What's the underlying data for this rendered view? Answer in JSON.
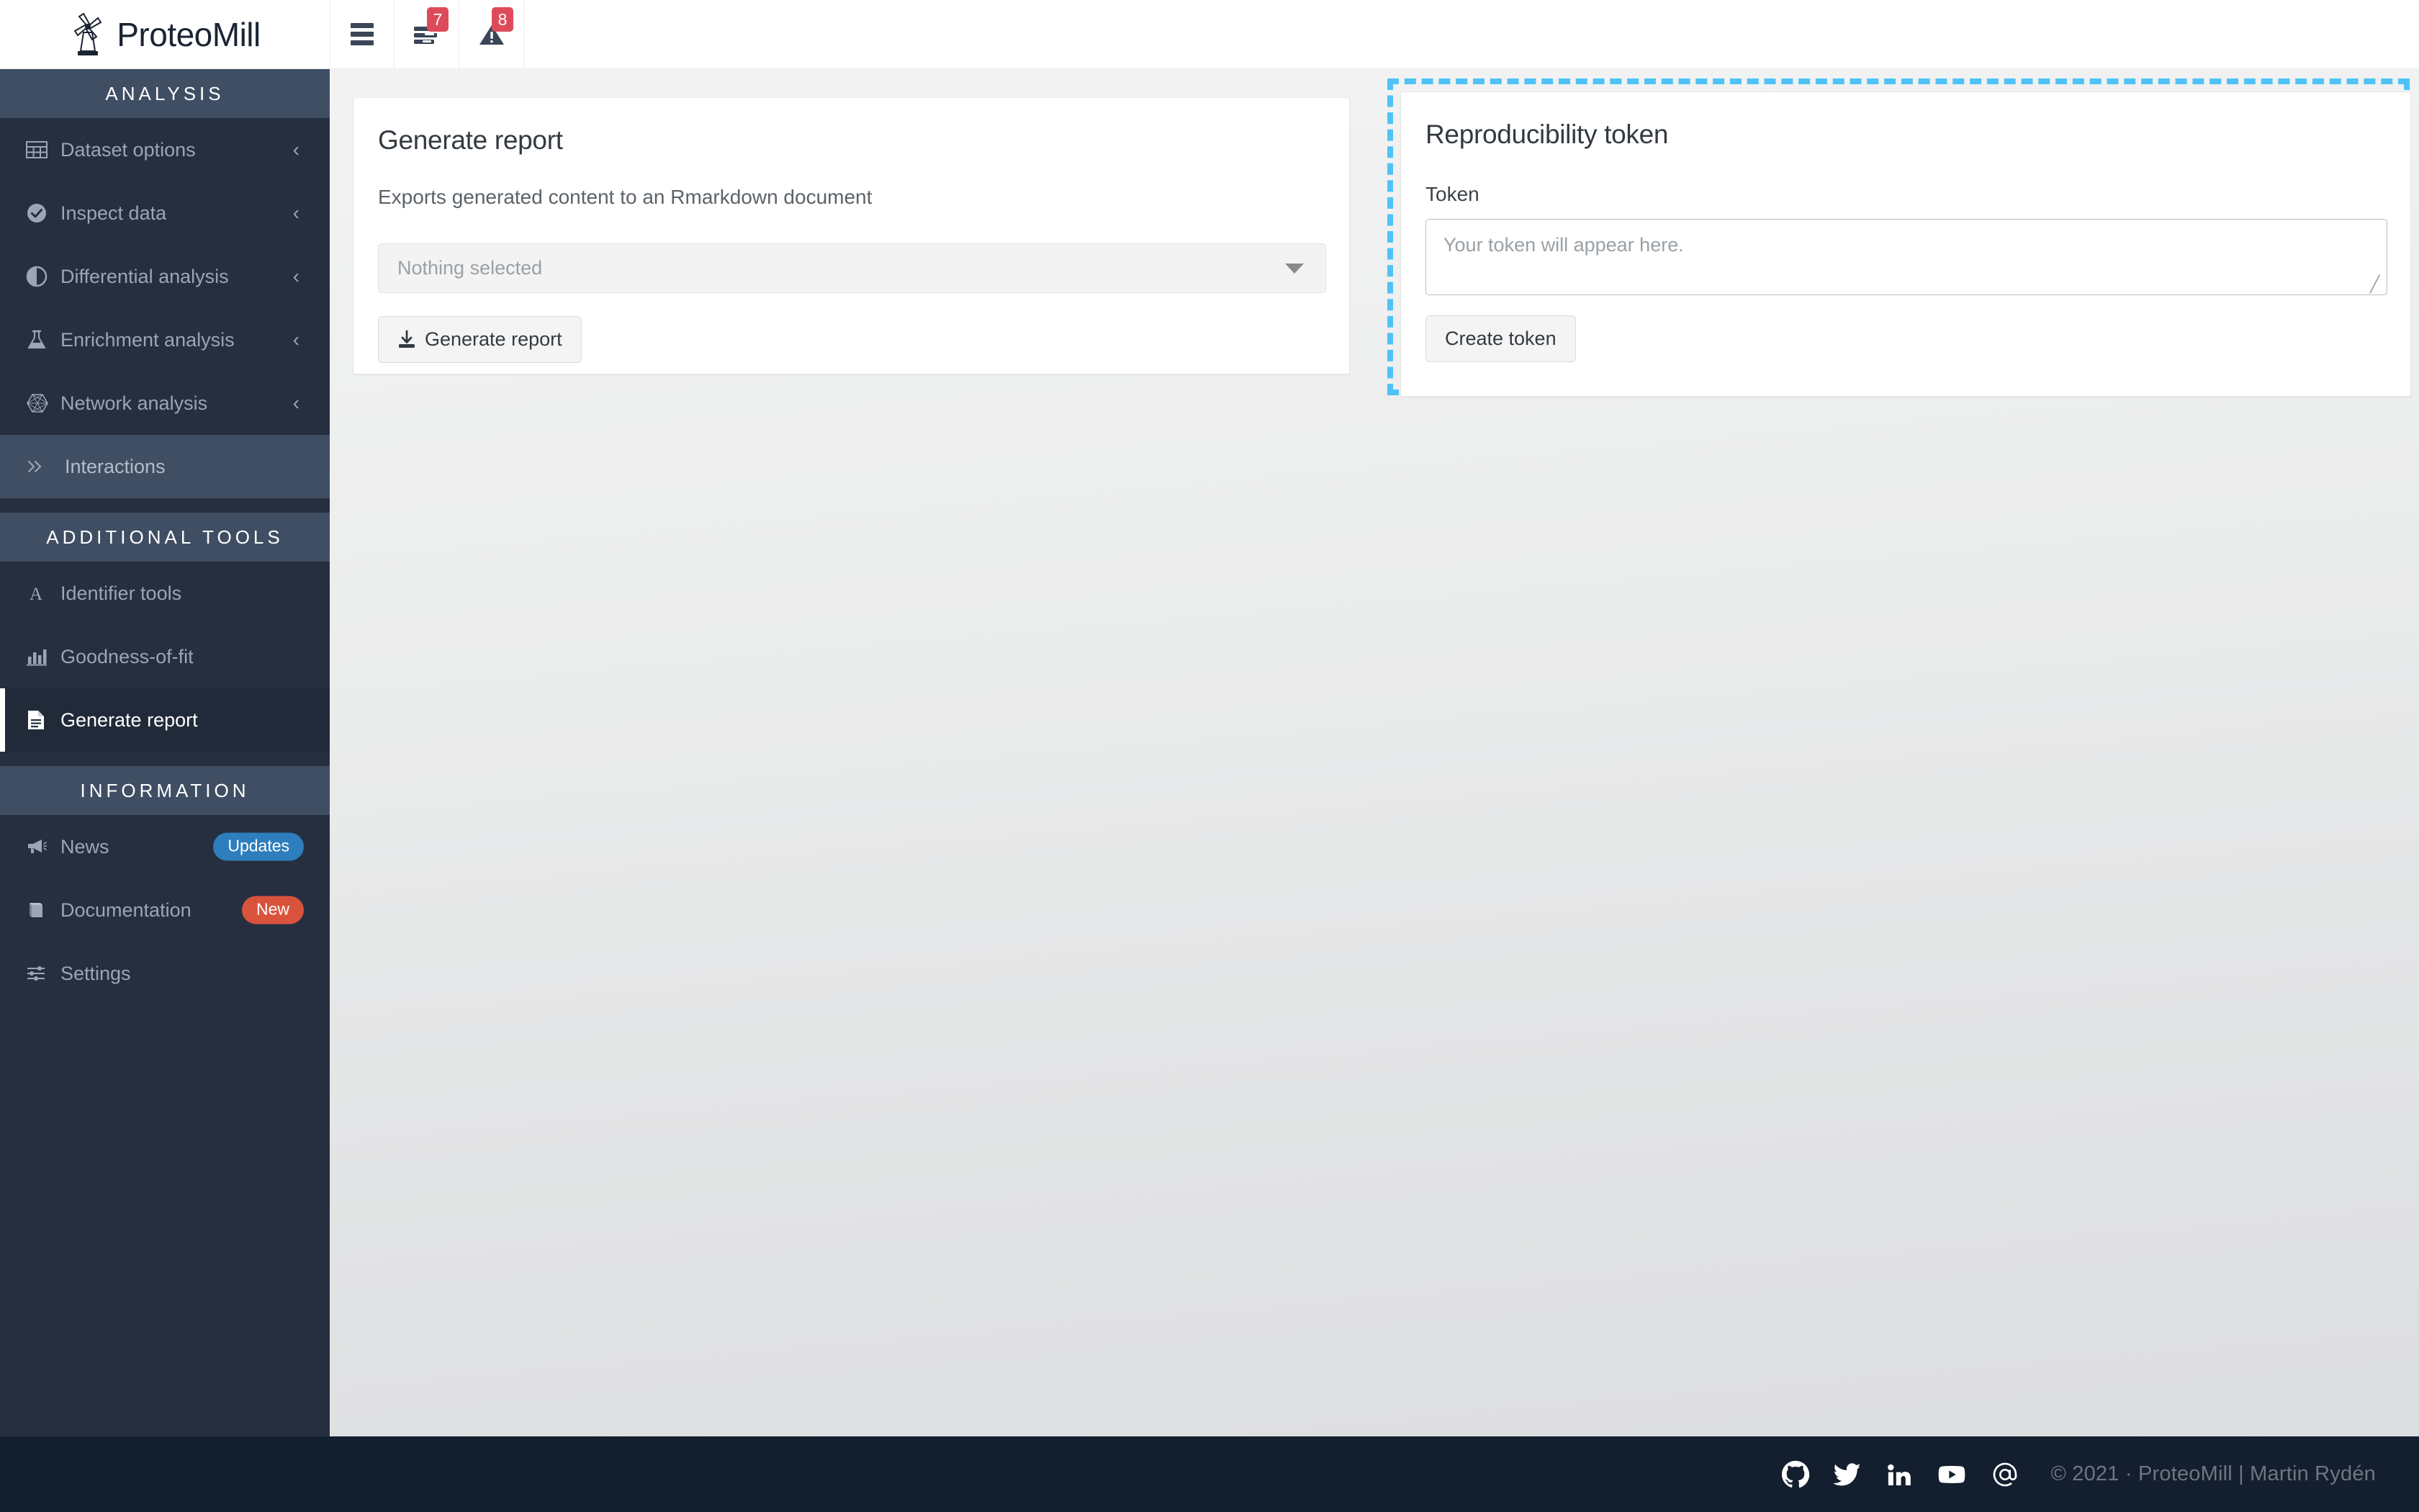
{
  "app": {
    "brand_name": "ProteoMill",
    "logo_icon": "windmill-icon"
  },
  "header": {
    "menu_toggle_icon": "hamburger-menu-icon",
    "tasks_icon": "tasks-list-icon",
    "tasks_badge": "7",
    "warnings_icon": "warning-triangle-icon",
    "warnings_badge": "8"
  },
  "sidebar": {
    "sections": [
      {
        "title": "ANALYSIS",
        "items": [
          {
            "label": "Dataset options",
            "icon": "table-icon",
            "caret": "‹",
            "state": "normal"
          },
          {
            "label": "Inspect data",
            "icon": "check-circle-icon",
            "caret": "‹",
            "state": "normal"
          },
          {
            "label": "Differential analysis",
            "icon": "half-circle-icon",
            "caret": "‹",
            "state": "normal"
          },
          {
            "label": "Enrichment analysis",
            "icon": "flask-icon",
            "caret": "‹",
            "state": "normal"
          },
          {
            "label": "Network analysis",
            "icon": "network-hexagon-icon",
            "caret": "‹",
            "state": "normal"
          },
          {
            "label": "Interactions",
            "icon": "double-chevron-right-icon",
            "caret": "",
            "state": "sub"
          }
        ]
      },
      {
        "title": "ADDITIONAL TOOLS",
        "items": [
          {
            "label": "Identifier tools",
            "icon": "font-letter-a-icon",
            "caret": "",
            "state": "normal"
          },
          {
            "label": "Goodness-of-fit",
            "icon": "bar-chart-icon",
            "caret": "",
            "state": "normal"
          },
          {
            "label": "Generate report",
            "icon": "document-lines-icon",
            "caret": "",
            "state": "active"
          }
        ]
      },
      {
        "title": "INFORMATION",
        "items": [
          {
            "label": "News",
            "icon": "megaphone-icon",
            "caret": "",
            "state": "normal",
            "pill": "Updates",
            "pill_color": "blue"
          },
          {
            "label": "Documentation",
            "icon": "book-icon",
            "caret": "",
            "state": "normal",
            "pill": "New",
            "pill_color": "red"
          },
          {
            "label": "Settings",
            "icon": "sliders-icon",
            "caret": "",
            "state": "normal"
          }
        ]
      }
    ]
  },
  "report_card": {
    "title": "Generate report",
    "description": "Exports generated content to an Rmarkdown document",
    "select_value": "Nothing selected",
    "select_caret_icon": "caret-down-icon",
    "generate_button_label": "Generate report",
    "generate_button_icon": "download-icon"
  },
  "token_card": {
    "title": "Reproducibility token",
    "field_label": "Token",
    "textarea_placeholder": "Your token will appear here.",
    "textarea_value": "",
    "create_button_label": "Create token",
    "highlight_color": "#4fc3f7"
  },
  "footer": {
    "social_links": [
      {
        "name": "github-icon",
        "title": "GitHub"
      },
      {
        "name": "twitter-icon",
        "title": "Twitter"
      },
      {
        "name": "linkedin-icon",
        "title": "LinkedIn"
      },
      {
        "name": "youtube-icon",
        "title": "YouTube"
      },
      {
        "name": "email-at-icon",
        "title": "Email"
      }
    ],
    "copyright": "© 2021 · ProteoMill | Martin Rydén"
  },
  "colors": {
    "sidebar_bg": "#262f3f",
    "sidebar_section_bg": "#3f4e63",
    "sidebar_active_bg": "#212a38",
    "badge_red": "#dd4b5a",
    "pill_blue": "#2e7ebd",
    "pill_red": "#d9533c",
    "footer_bg": "#131f2e",
    "highlight_blue": "#4fc3f7"
  }
}
